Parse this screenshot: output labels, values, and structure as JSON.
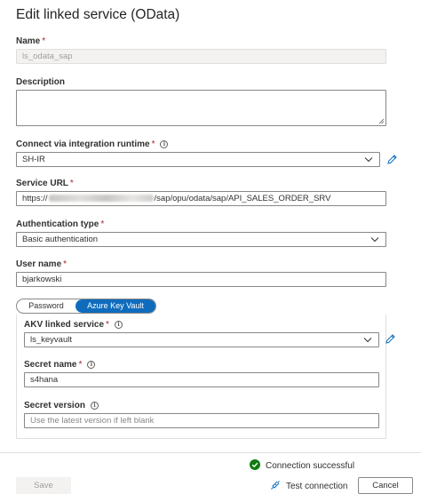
{
  "title": "Edit linked service (OData)",
  "required_mark": "*",
  "info_glyph": "i",
  "name": {
    "label": "Name",
    "value": "ls_odata_sap"
  },
  "description": {
    "label": "Description",
    "value": ""
  },
  "runtime": {
    "label": "Connect via integration runtime",
    "value": "SH-IR"
  },
  "service_url": {
    "label": "Service URL",
    "prefix": "https://",
    "suffix": "/sap/opu/odata/sap/API_SALES_ORDER_SRV"
  },
  "auth_type": {
    "label": "Authentication type",
    "value": "Basic authentication"
  },
  "user_name": {
    "label": "User name",
    "value": "bjarkowski"
  },
  "toggle": {
    "password_label": "Password",
    "akv_label": "Azure Key Vault",
    "selected": "Azure Key Vault"
  },
  "akv": {
    "linked_service_label": "AKV linked service",
    "linked_service_value": "ls_keyvault",
    "secret_name_label": "Secret name",
    "secret_name_value": "s4hana",
    "secret_version_label": "Secret version",
    "secret_version_placeholder": "Use the latest version if left blank"
  },
  "status": {
    "text": "Connection successful",
    "color": "#107c10"
  },
  "footer": {
    "save_label": "Save",
    "test_connection_label": "Test connection",
    "cancel_label": "Cancel"
  },
  "colors": {
    "accent": "#0f6cbd",
    "required": "#a4262c"
  }
}
